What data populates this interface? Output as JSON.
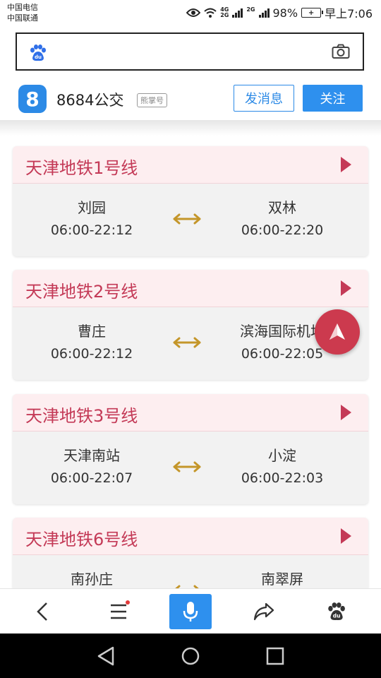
{
  "status_bar": {
    "carrier1": "中国电信",
    "carrier2": "中国联通",
    "sig1_top": "4G",
    "sig1_bottom": "2G",
    "sig2": "2G",
    "battery": "98%",
    "time": "早上7:06"
  },
  "search": {
    "placeholder": ""
  },
  "account": {
    "logo_text": "8",
    "name": "8684公交",
    "badge": "熊掌号",
    "message_button": "发消息",
    "follow_button": "关注"
  },
  "lines": [
    {
      "title": "天津地铁1号线",
      "start": "刘园",
      "start_time": "06:00-22:12",
      "end": "双林",
      "end_time": "06:00-22:20"
    },
    {
      "title": "天津地铁2号线",
      "start": "曹庄",
      "start_time": "06:00-22:12",
      "end": "滨海国际机场",
      "end_time": "06:00-22:05"
    },
    {
      "title": "天津地铁3号线",
      "start": "天津南站",
      "start_time": "06:00-22:07",
      "end": "小淀",
      "end_time": "06:00-22:03"
    },
    {
      "title": "天津地铁6号线",
      "start": "南孙庄",
      "start_time": "",
      "end": "南翠屏",
      "end_time": ""
    }
  ],
  "colors": {
    "accent_blue": "#2e90ee",
    "line_red": "#c43a57",
    "arrow_gold": "#c4962a",
    "fab_red": "#cc3a4e"
  },
  "icons": {
    "search_logo": "baidu-paw-icon",
    "camera": "camera-icon",
    "back": "back-arrow-icon",
    "menu": "menu-icon",
    "mic": "microphone-icon",
    "share": "share-icon",
    "home": "baidu-paw-icon"
  }
}
